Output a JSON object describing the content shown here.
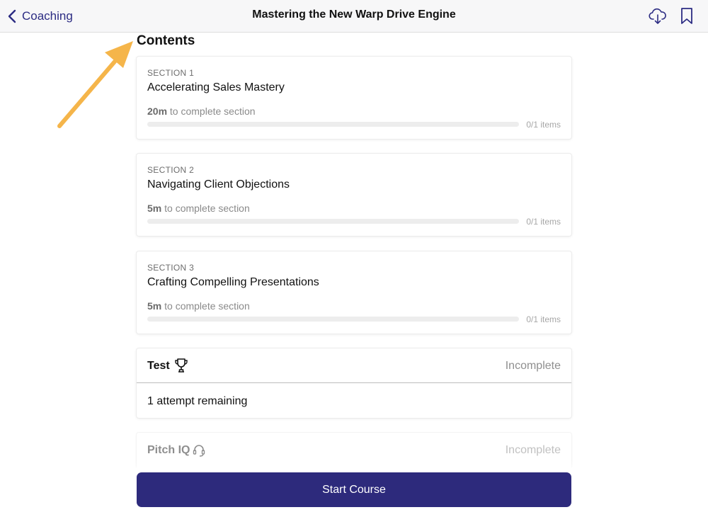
{
  "nav": {
    "back_label": "Coaching",
    "title": "Mastering the New Warp Drive Engine",
    "icons": {
      "back": "chevron-left-icon",
      "download": "cloud-download-icon",
      "bookmark": "bookmark-icon"
    }
  },
  "contents": {
    "heading": "Contents",
    "sections": [
      {
        "label": "SECTION 1",
        "title": "Accelerating Sales Mastery",
        "duration": "20m",
        "duration_suffix": "to complete section",
        "progress": 0,
        "items": "0/1 items"
      },
      {
        "label": "SECTION 2",
        "title": "Navigating Client Objections",
        "duration": "5m",
        "duration_suffix": "to complete section",
        "progress": 0,
        "items": "0/1 items"
      },
      {
        "label": "SECTION 3",
        "title": "Crafting Compelling Presentations",
        "duration": "5m",
        "duration_suffix": "to complete section",
        "progress": 0,
        "items": "0/1 items"
      }
    ],
    "test": {
      "title": "Test",
      "icon": "trophy-icon",
      "status": "Incomplete",
      "attempts": "1 attempt remaining"
    },
    "pitch_iq": {
      "title": "Pitch IQ",
      "icon": "headset-icon",
      "status": "Incomplete"
    }
  },
  "footer": {
    "start_label": "Start Course"
  },
  "colors": {
    "accent": "#2d2a7c",
    "back_link": "#2c2c83",
    "annotation_arrow": "#f5b54a"
  }
}
